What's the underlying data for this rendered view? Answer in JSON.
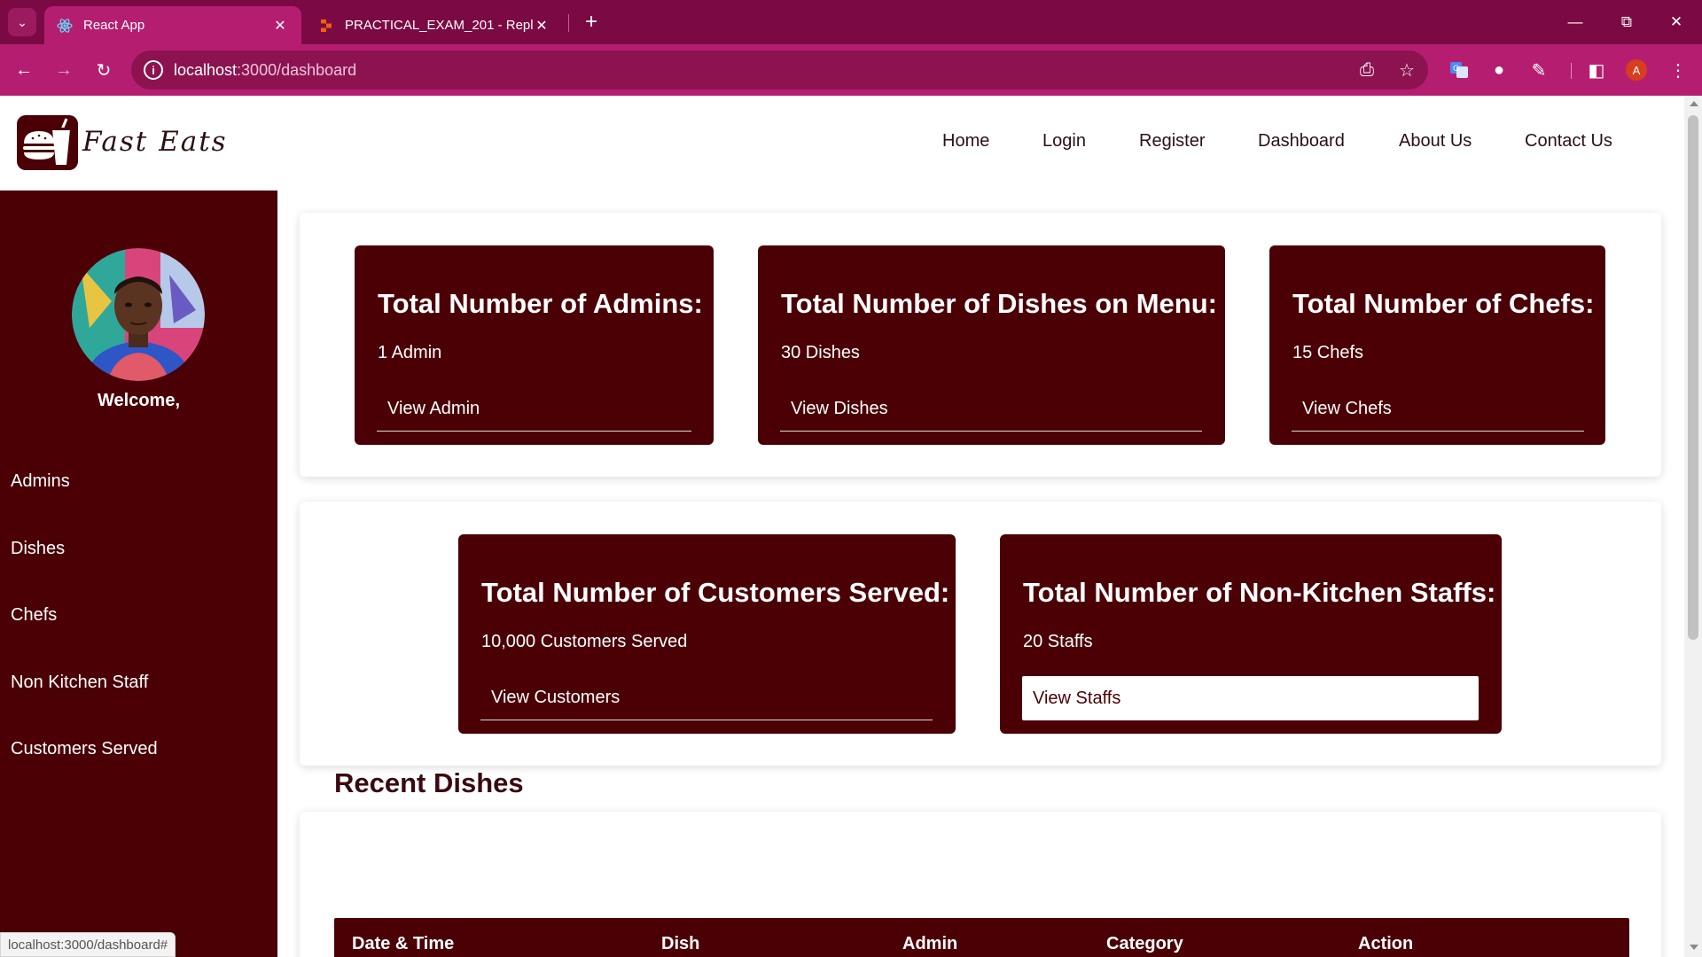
{
  "browser": {
    "tabs": [
      {
        "title": "React App",
        "active": true,
        "favicon": "react-icon"
      },
      {
        "title": "PRACTICAL_EXAM_201 - Replit",
        "active": false,
        "favicon": "replit-icon"
      }
    ],
    "url_host": "localhost",
    "url_path": ":3000/dashboard",
    "profile_initial": "A",
    "status_url": "localhost:3000/dashboard#"
  },
  "site": {
    "brand": "Fast Eats",
    "nav": [
      "Home",
      "Login",
      "Register",
      "Dashboard",
      "About Us",
      "Contact Us"
    ]
  },
  "sidebar": {
    "welcome": "Welcome,",
    "items": [
      "Admins",
      "Dishes",
      "Chefs",
      "Non Kitchen Staff",
      "Customers Served"
    ]
  },
  "cards": [
    {
      "title": "Total Number of Admins:",
      "count": "1 Admin",
      "link": "View Admin"
    },
    {
      "title": "Total Number of Dishes on Menu:",
      "count": "30 Dishes",
      "link": "View Dishes"
    },
    {
      "title": "Total Number of Chefs:",
      "count": "15 Chefs",
      "link": "View Chefs"
    },
    {
      "title": "Total Number of Customers Served:",
      "count": "10,000 Customers Served",
      "link": "View Customers"
    },
    {
      "title": "Total Number of Non-Kitchen Staffs:",
      "count": "20 Staffs",
      "link": "View Staffs"
    }
  ],
  "recent": {
    "title": "Recent Dishes",
    "columns": [
      "Date & Time",
      "Dish",
      "Admin",
      "Category",
      "Action"
    ]
  },
  "colors": {
    "brand_maroon": "#4a0005",
    "chrome_tabstrip": "#7b0a44",
    "chrome_toolbar": "#b51e70"
  }
}
